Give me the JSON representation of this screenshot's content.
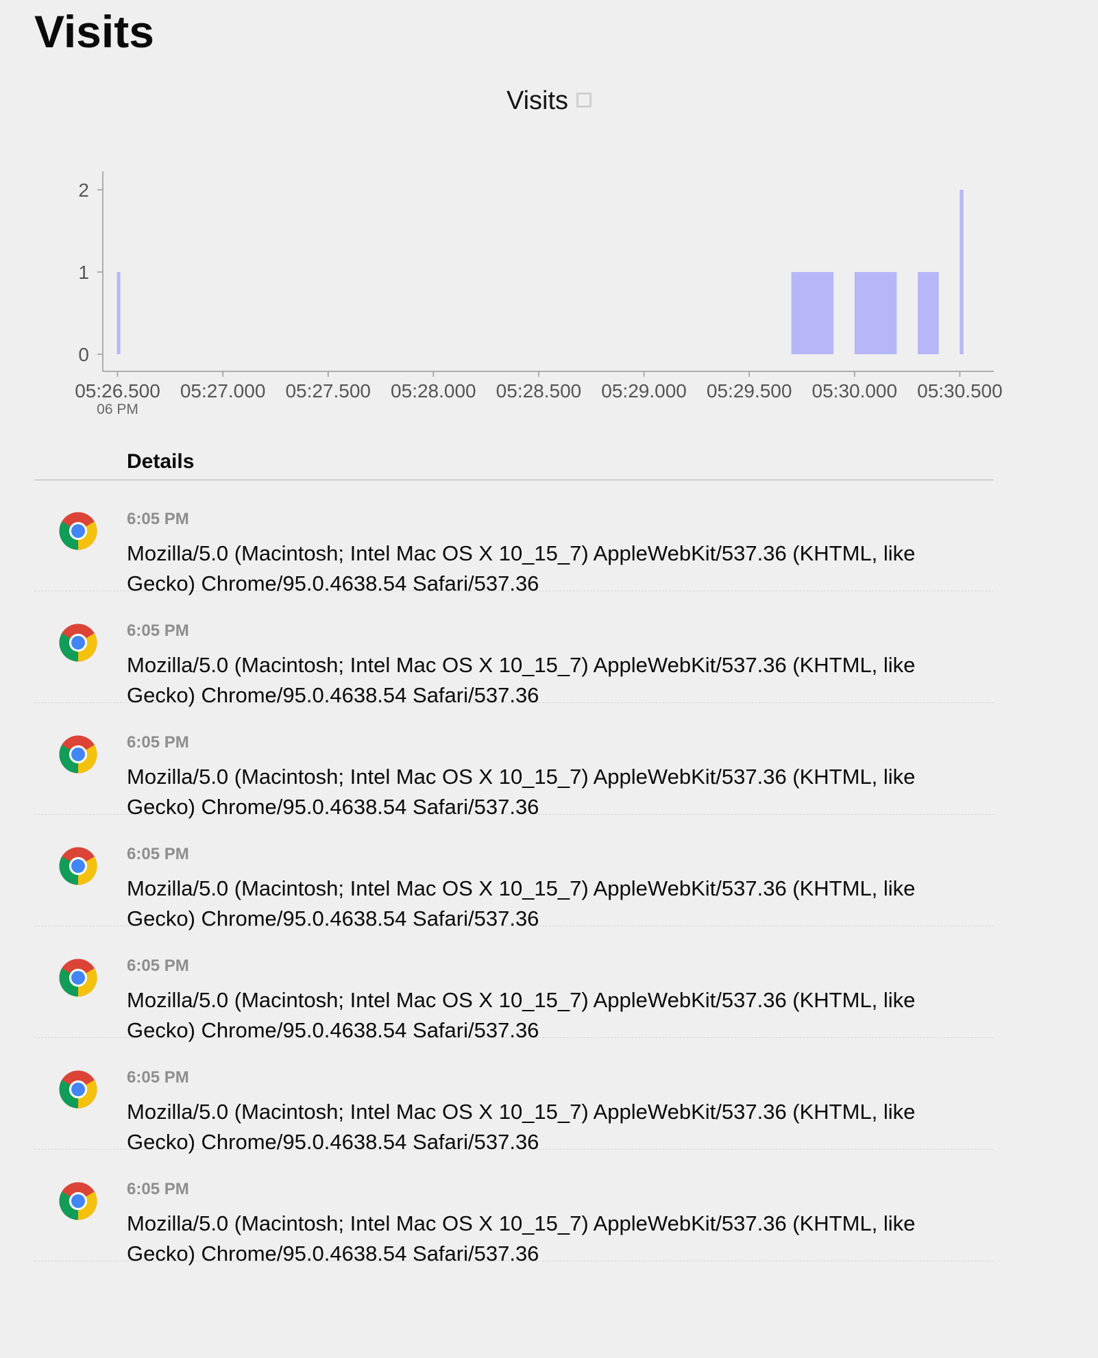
{
  "page": {
    "title": "Visits"
  },
  "chart": {
    "title": "Visits",
    "bar_color": "#b6b6f8",
    "axis_color": "#999999"
  },
  "chart_data": {
    "type": "bar",
    "title": "Visits",
    "xlabel": "",
    "ylabel": "",
    "ylim": [
      0,
      2
    ],
    "xlim": [
      26.43,
      30.58
    ],
    "y_ticks": [
      0,
      1,
      2
    ],
    "x_ticks": [
      {
        "value": 26.5,
        "label": "05:26.500",
        "sublabel": "06 PM"
      },
      {
        "value": 27.0,
        "label": "05:27.000"
      },
      {
        "value": 27.5,
        "label": "05:27.500"
      },
      {
        "value": 28.0,
        "label": "05:28.000"
      },
      {
        "value": 28.5,
        "label": "05:28.500"
      },
      {
        "value": 29.0,
        "label": "05:29.000"
      },
      {
        "value": 29.5,
        "label": "05:29.500"
      },
      {
        "value": 30.0,
        "label": "05:30.000"
      },
      {
        "value": 30.5,
        "label": "05:30.500"
      }
    ],
    "bars": [
      {
        "x0": 26.497,
        "x1": 26.513,
        "value": 1
      },
      {
        "x0": 29.7,
        "x1": 29.9,
        "value": 1
      },
      {
        "x0": 30.0,
        "x1": 30.2,
        "value": 1
      },
      {
        "x0": 30.3,
        "x1": 30.4,
        "value": 1
      },
      {
        "x0": 30.5,
        "x1": 30.517,
        "value": 2
      }
    ],
    "grid": false,
    "legend": "top-center"
  },
  "details": {
    "header": "Details",
    "items": [
      {
        "icon": "chrome-icon",
        "time": "6:05 PM",
        "user_agent": "Mozilla/5.0 (Macintosh; Intel Mac OS X 10_15_7) AppleWebKit/537.36 (KHTML, like Gecko) Chrome/95.0.4638.54 Safari/537.36"
      },
      {
        "icon": "chrome-icon",
        "time": "6:05 PM",
        "user_agent": "Mozilla/5.0 (Macintosh; Intel Mac OS X 10_15_7) AppleWebKit/537.36 (KHTML, like Gecko) Chrome/95.0.4638.54 Safari/537.36"
      },
      {
        "icon": "chrome-icon",
        "time": "6:05 PM",
        "user_agent": "Mozilla/5.0 (Macintosh; Intel Mac OS X 10_15_7) AppleWebKit/537.36 (KHTML, like Gecko) Chrome/95.0.4638.54 Safari/537.36"
      },
      {
        "icon": "chrome-icon",
        "time": "6:05 PM",
        "user_agent": "Mozilla/5.0 (Macintosh; Intel Mac OS X 10_15_7) AppleWebKit/537.36 (KHTML, like Gecko) Chrome/95.0.4638.54 Safari/537.36"
      },
      {
        "icon": "chrome-icon",
        "time": "6:05 PM",
        "user_agent": "Mozilla/5.0 (Macintosh; Intel Mac OS X 10_15_7) AppleWebKit/537.36 (KHTML, like Gecko) Chrome/95.0.4638.54 Safari/537.36"
      },
      {
        "icon": "chrome-icon",
        "time": "6:05 PM",
        "user_agent": "Mozilla/5.0 (Macintosh; Intel Mac OS X 10_15_7) AppleWebKit/537.36 (KHTML, like Gecko) Chrome/95.0.4638.54 Safari/537.36"
      },
      {
        "icon": "chrome-icon",
        "time": "6:05 PM",
        "user_agent": "Mozilla/5.0 (Macintosh; Intel Mac OS X 10_15_7) AppleWebKit/537.36 (KHTML, like Gecko) Chrome/95.0.4638.54 Safari/537.36"
      }
    ]
  }
}
